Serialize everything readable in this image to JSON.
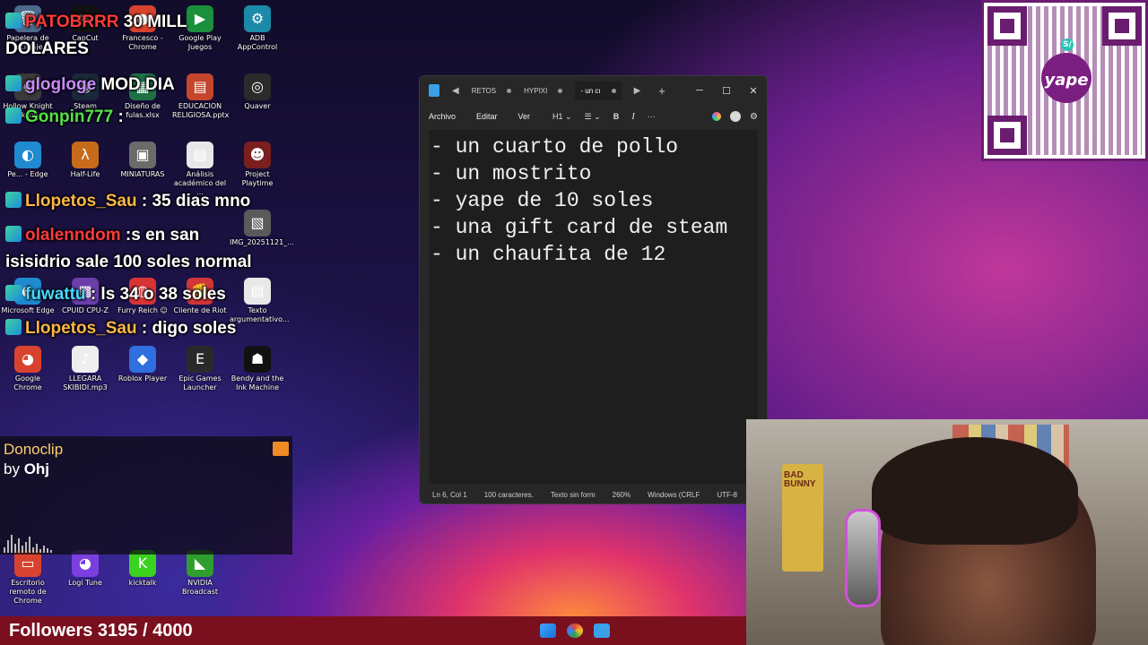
{
  "desktop": {
    "icons": [
      {
        "label": "Papelera de reciclaje",
        "glyph": "🗑",
        "color": "#4b6a8c"
      },
      {
        "label": "CapCut",
        "glyph": "✂",
        "color": "#111111"
      },
      {
        "label": "Francesco - Chrome",
        "glyph": "●",
        "color": "#d8432f"
      },
      {
        "label": "Google Play Juegos",
        "glyph": "▶",
        "color": "#1b8f3b"
      },
      {
        "label": "ADB AppControl",
        "glyph": "⚙",
        "color": "#1a8aa8"
      },
      {
        "label": "Hollow Knight Silksong",
        "glyph": "♞",
        "color": "#3a3a3a"
      },
      {
        "label": "Steam",
        "glyph": "◉",
        "color": "#1b2838"
      },
      {
        "label": "Diseño de fulas.xlsx",
        "glyph": "▦",
        "color": "#1e7145"
      },
      {
        "label": "EDUCACION RELIGIOSA.pptx",
        "glyph": "▤",
        "color": "#c4462d"
      },
      {
        "label": "Quaver",
        "glyph": "◎",
        "color": "#2b2b2b"
      },
      {
        "label": "Pe... - Edge",
        "glyph": "◐",
        "color": "#1f8acf"
      },
      {
        "label": "Half-Life",
        "glyph": "λ",
        "color": "#c76a1a"
      },
      {
        "label": "MINIATURAS",
        "glyph": "▣",
        "color": "#6b6b6b"
      },
      {
        "label": "Análisis académico del ...",
        "glyph": "▤",
        "color": "#e8e8e8"
      },
      {
        "label": "Project Playtime",
        "glyph": "☻",
        "color": "#7a1e1e"
      },
      {
        "label": "Microsoft Edge",
        "glyph": "◐",
        "color": "#1f8acf"
      },
      {
        "label": "CPUID CPU-Z",
        "glyph": "▩",
        "color": "#6b3ea8"
      },
      {
        "label": "Furry Reich ☺",
        "glyph": "◍",
        "color": "#d83434"
      },
      {
        "label": "Cliente de Riot",
        "glyph": "✊",
        "color": "#d13639"
      },
      {
        "label": "Texto argumentativo...",
        "glyph": "▤",
        "color": "#e8e8e8"
      },
      {
        "label": "Google Chrome",
        "glyph": "◕",
        "color": "#d8432f"
      },
      {
        "label": "LLEGARA SKIBIDI.mp3",
        "glyph": "♪",
        "color": "#eeeeee"
      },
      {
        "label": "Roblox Player",
        "glyph": "◆",
        "color": "#2f6fe0"
      },
      {
        "label": "Epic Games Launcher",
        "glyph": "E",
        "color": "#2a2a2a"
      },
      {
        "label": "Bendy and the Ink Machine",
        "glyph": "☗",
        "color": "#111111"
      },
      {
        "label": "IMG_20251121_...",
        "glyph": "▧",
        "color": "#5a5a5a"
      },
      {
        "label": "Escritorio remoto de Chrome",
        "glyph": "▭",
        "color": "#d8432f"
      },
      {
        "label": "Logi Tune",
        "glyph": "◕",
        "color": "#7b3fe0"
      },
      {
        "label": "kicktalk",
        "glyph": "K",
        "color": "#3ad11f"
      },
      {
        "label": "NVIDIA Broadcast",
        "glyph": "◣",
        "color": "#2f9e2f"
      }
    ]
  },
  "chat": [
    {
      "user": "PATOBRRR",
      "text": " 30 MILL"
    },
    {
      "user": "",
      "text": "DOLARES"
    },
    {
      "user": "glogloge",
      "text": " MOD  DIA"
    },
    {
      "user": "Gonpin777",
      "text": " :"
    },
    {
      "user": "Llopetos_Sau",
      "text": " : 35 dias mno"
    },
    {
      "user": "olalenndom",
      "text": " :s en san"
    },
    {
      "user": "",
      "text": "isisidrio sale 100 soles normal"
    },
    {
      "user": "fuwattu",
      "text": " : ls 34 o 38 soles"
    },
    {
      "user": "Llopetos_Sau",
      "text": " : digo soles"
    }
  ],
  "notepad": {
    "tabs": [
      {
        "label": "RETOS"
      },
      {
        "label": "HYPIXI"
      },
      {
        "label": "- un cı"
      }
    ],
    "nav_back": "◀",
    "nav_forward": "▶",
    "new_tab": "+",
    "window_controls": {
      "minimize": "─",
      "maximize": "☐",
      "close": "✕"
    },
    "menus": {
      "file": "Archivo",
      "edit": "Editar",
      "view": "Ver"
    },
    "toolbar": {
      "heading": "H1 ⌄",
      "list": "☰ ⌄",
      "bold": "B",
      "italic": "I",
      "more": "···",
      "settings": "⚙"
    },
    "lines": [
      "- un cuarto de pollo",
      "- un mostrito",
      "- yape de 10 soles",
      "- una gift card de steam",
      "- un chaufita de 12"
    ],
    "status": {
      "position": "Ln 6, Col 1",
      "chars": "100 caracteres.",
      "format": "Texto sin form",
      "zoom": "260%",
      "eol": "Windows (CRLF",
      "encoding": "UTF-8"
    }
  },
  "donoclip": {
    "title": "Donoclip",
    "by_prefix": "by ",
    "by_name": "Ohj"
  },
  "qr": {
    "brand": "yape",
    "mark": "S/"
  },
  "webcam": {
    "poster_text": "BAD BUNNY"
  },
  "followers": {
    "text": "Followers 3195 / 4000"
  }
}
